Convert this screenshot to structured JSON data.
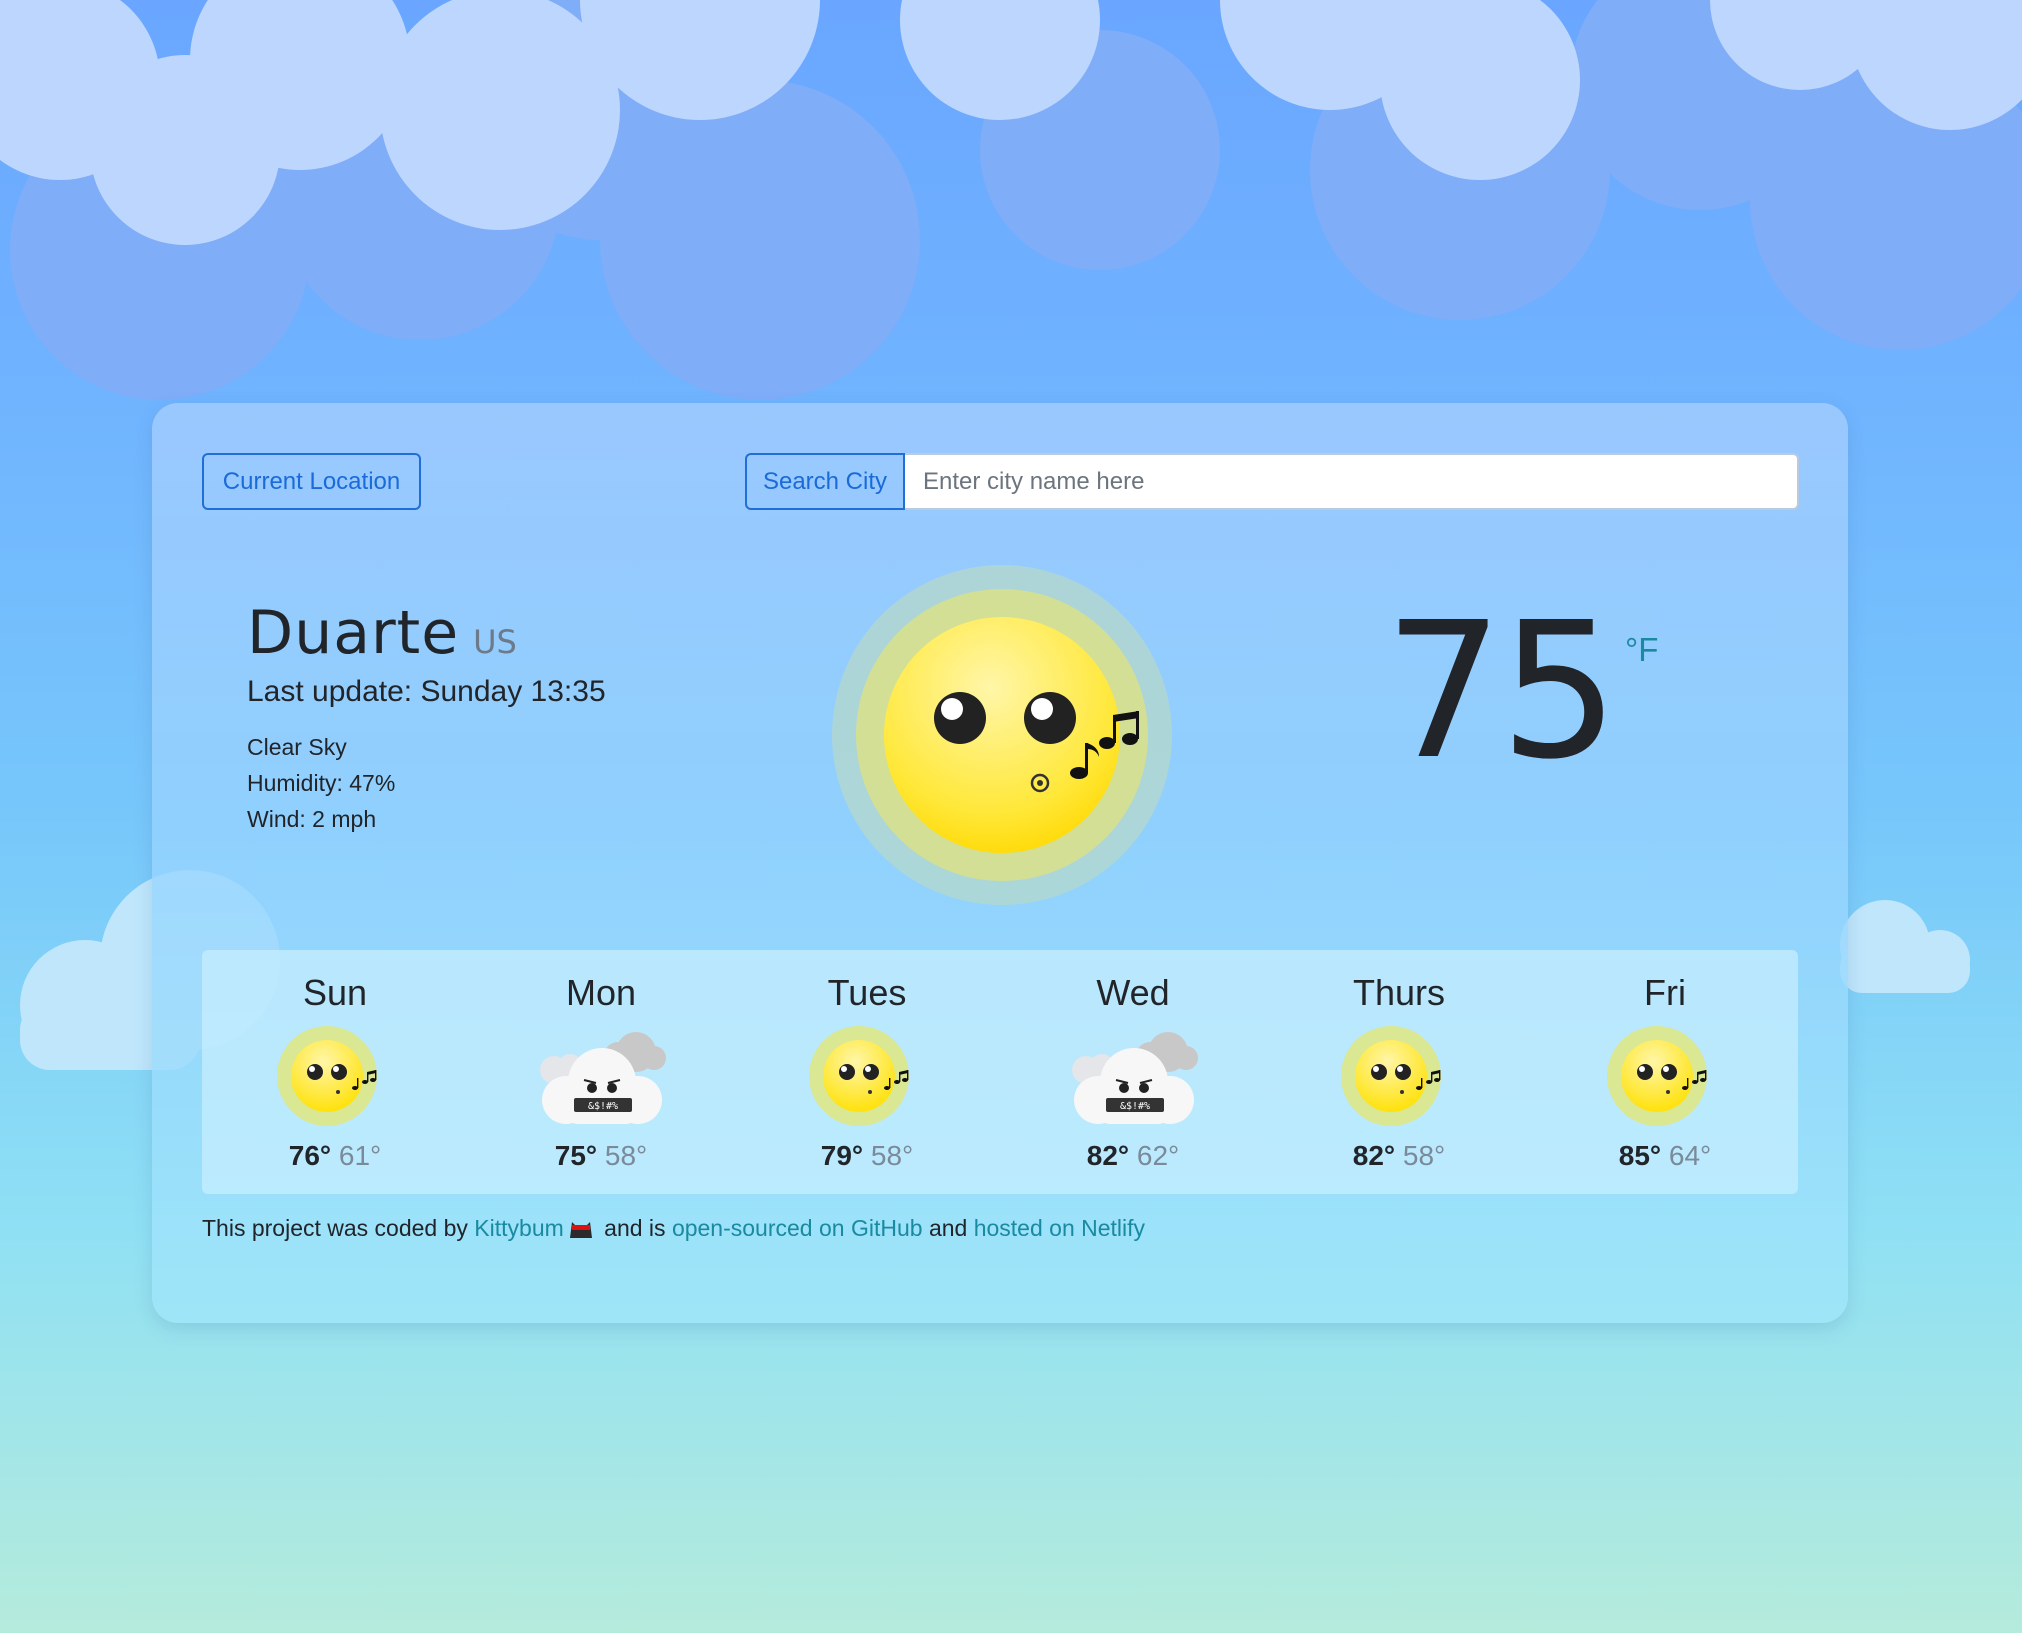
{
  "controls": {
    "current_location_label": "Current Location",
    "search_city_label": "Search City",
    "search_placeholder": "Enter city name here",
    "search_value": ""
  },
  "current": {
    "city": "Duarte",
    "country": "US",
    "last_update": "Last update: Sunday 13:35",
    "description": "Clear Sky",
    "humidity": "Humidity: 47%",
    "wind": "Wind: 2 mph",
    "temperature": "75",
    "unit": "°F",
    "icon": "sun-singing-icon"
  },
  "forecast": [
    {
      "day": "Sun",
      "icon": "sun-singing-icon",
      "max": "76°",
      "min": "61°"
    },
    {
      "day": "Mon",
      "icon": "cloud-grumpy-icon",
      "max": "75°",
      "min": "58°"
    },
    {
      "day": "Tues",
      "icon": "sun-singing-icon",
      "max": "79°",
      "min": "58°"
    },
    {
      "day": "Wed",
      "icon": "cloud-grumpy-icon",
      "max": "82°",
      "min": "62°"
    },
    {
      "day": "Thurs",
      "icon": "sun-singing-icon",
      "max": "82°",
      "min": "58°"
    },
    {
      "day": "Fri",
      "icon": "sun-singing-icon",
      "max": "85°",
      "min": "64°"
    }
  ],
  "footer": {
    "prefix": "This project was coded by",
    "author_link": "Kittybum",
    "middle": "and is",
    "github_link": "open-sourced on GitHub",
    "and": "and",
    "netlify_link": "hosted on Netlify"
  },
  "colors": {
    "primary": "#1a6bd8",
    "link": "#1a8aa0",
    "text": "#212529",
    "muted": "#7a8a99"
  }
}
